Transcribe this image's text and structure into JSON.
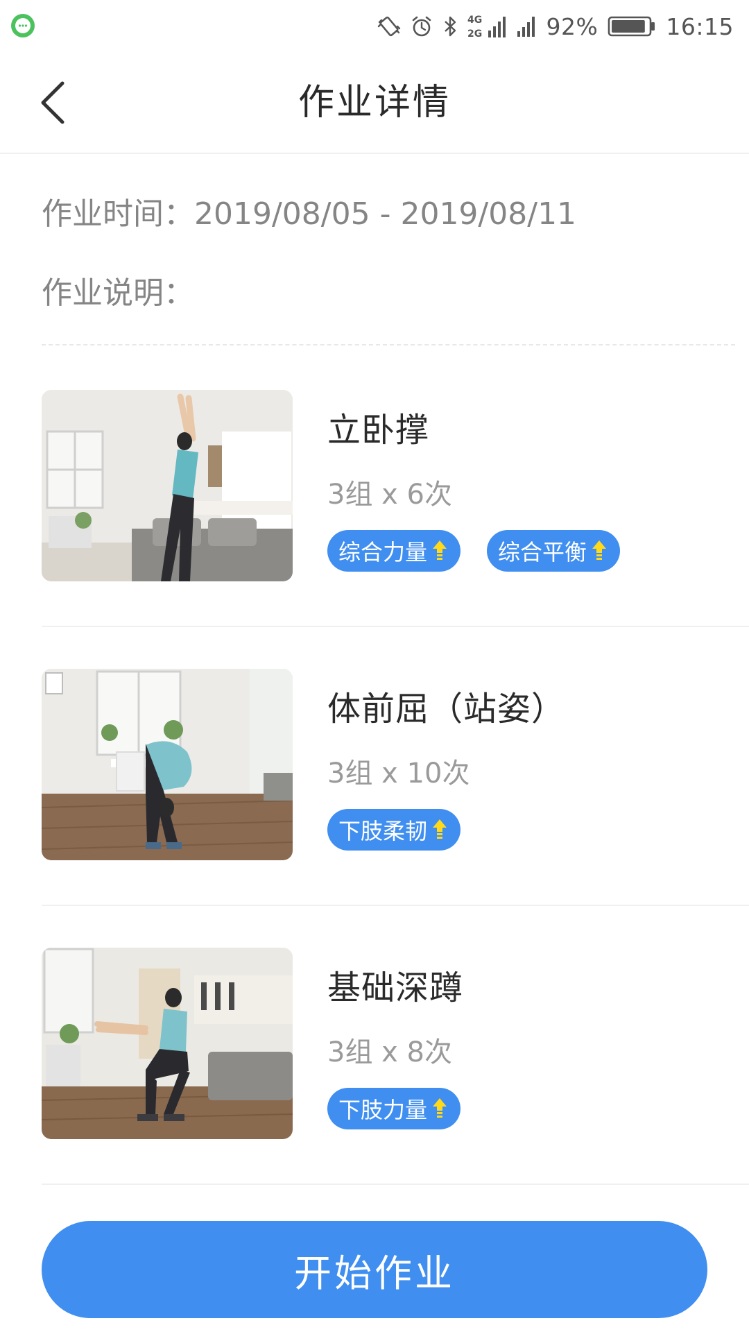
{
  "status_bar": {
    "battery_percent": "92%",
    "time": "16:15",
    "battery_level": 0.92,
    "icons": [
      "notification-app-icon",
      "vibrate-icon",
      "alarm-icon",
      "bluetooth-icon",
      "network-4g-2g-icon",
      "signal-icon",
      "battery-icon"
    ],
    "network_label_top": "4G",
    "network_label_bottom": "2G"
  },
  "header": {
    "title": "作业详情",
    "back_icon": "chevron-left-icon"
  },
  "info": {
    "time_label": "作业时间：",
    "time_value": "2019/08/05 - 2019/08/11",
    "desc_label": "作业说明：",
    "desc_value": ""
  },
  "exercises": [
    {
      "name": "立卧撑",
      "reps": "3组 x 6次",
      "tags": [
        "综合力量",
        "综合平衡"
      ]
    },
    {
      "name": "体前屈（站姿）",
      "reps": "3组 x 10次",
      "tags": [
        "下肢柔韧"
      ]
    },
    {
      "name": "基础深蹲",
      "reps": "3组 x 8次",
      "tags": [
        "下肢力量"
      ]
    }
  ],
  "colors": {
    "accent": "#3f8ef0",
    "tag_arrow": "#ffd91a",
    "title_text": "#2a2a2a",
    "secondary_text": "#858585"
  },
  "footer": {
    "start_label": "开始作业"
  }
}
